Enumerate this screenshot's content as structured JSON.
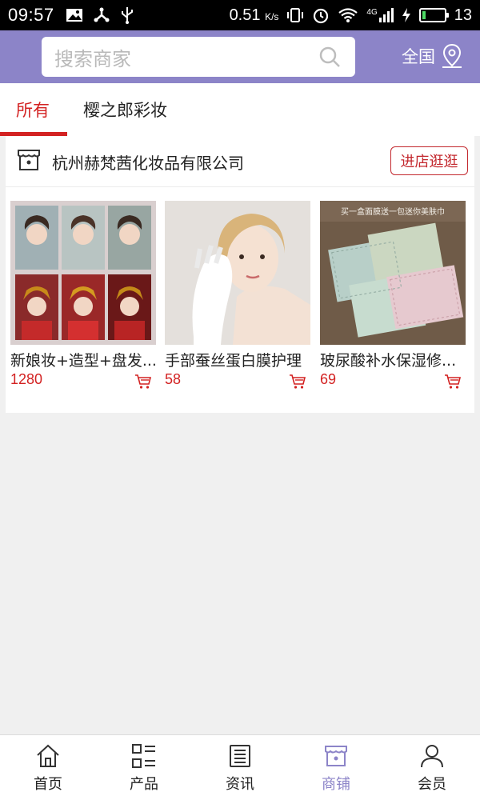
{
  "status_bar": {
    "time": "09:57",
    "speed": "0.51",
    "speed_unit": "K/s",
    "network": "4G",
    "battery": "13"
  },
  "header": {
    "search_placeholder": "搜索商家",
    "region_label": "全国",
    "colors": {
      "accent": "#8c84c8"
    }
  },
  "tabs": [
    {
      "label": "所有",
      "active": true
    },
    {
      "label": "樱之郎彩妆",
      "active": false
    }
  ],
  "shop": {
    "name": "杭州赫梵茜化妆品有限公司",
    "visit_label": "进店逛逛",
    "products": [
      {
        "name": "新娘妆+造型+盘发...",
        "price": "1280"
      },
      {
        "name": "手部蚕丝蛋白膜护理",
        "price": "58"
      },
      {
        "name": "玻尿酸补水保湿修...",
        "price": "69",
        "image_caption": "买一盒面膜送一包迷你美肤巾"
      }
    ]
  },
  "bottom_nav": [
    {
      "label": "首页",
      "icon": "home-icon"
    },
    {
      "label": "产品",
      "icon": "grid-list-icon"
    },
    {
      "label": "资讯",
      "icon": "news-icon"
    },
    {
      "label": "商铺",
      "icon": "store-icon",
      "active": true
    },
    {
      "label": "会员",
      "icon": "user-icon"
    }
  ]
}
